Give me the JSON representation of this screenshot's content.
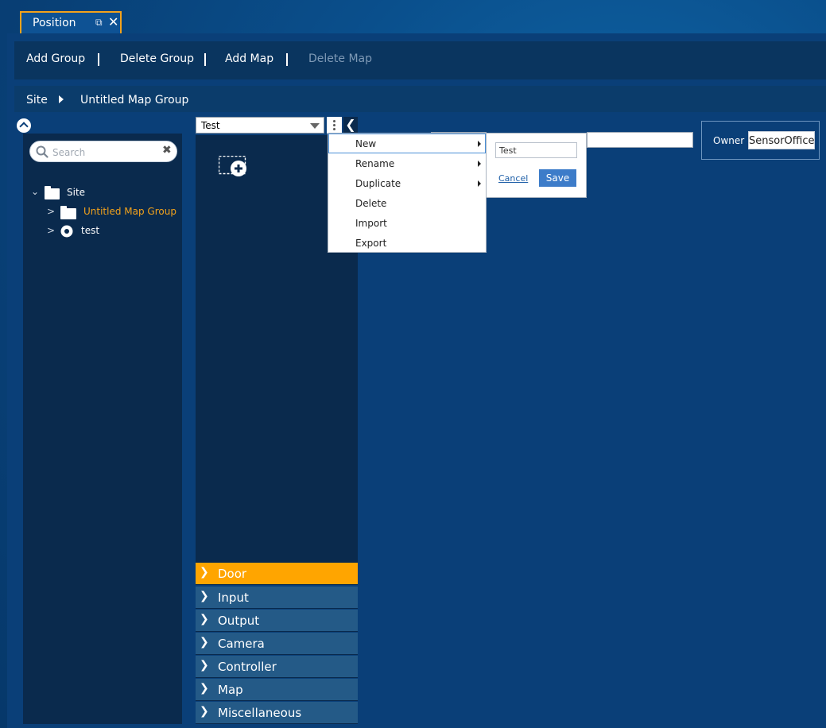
{
  "tab": {
    "title": "Position"
  },
  "toolbar": {
    "add_group": "Add Group",
    "delete_group": "Delete Group",
    "add_map": "Add Map",
    "delete_map": "Delete Map"
  },
  "breadcrumb": {
    "site": "Site",
    "group": "Untitled Map Group"
  },
  "tree": {
    "search_placeholder": "Search",
    "root": "Site",
    "items": [
      {
        "label": "Untitled Map Group",
        "color": "#f3a21b"
      },
      {
        "label": "test"
      }
    ]
  },
  "map_selector": {
    "value": "Test"
  },
  "context_menu": {
    "items": [
      {
        "label": "New"
      },
      {
        "label": "Rename"
      },
      {
        "label": "Duplicate"
      },
      {
        "label": "Delete"
      },
      {
        "label": "Import"
      },
      {
        "label": "Export"
      }
    ]
  },
  "name_popup": {
    "value": "Test",
    "cancel": "Cancel",
    "save": "Save"
  },
  "owner": {
    "label": "Owner",
    "value": "SensorOffice"
  },
  "accordion": [
    {
      "label": "Door"
    },
    {
      "label": "Input"
    },
    {
      "label": "Output"
    },
    {
      "label": "Camera"
    },
    {
      "label": "Controller"
    },
    {
      "label": "Map"
    },
    {
      "label": "Miscellaneous"
    }
  ],
  "colors": {
    "accent": "#ffa500",
    "tab_border": "#f3a21b",
    "save_button": "#3d7cc9"
  }
}
